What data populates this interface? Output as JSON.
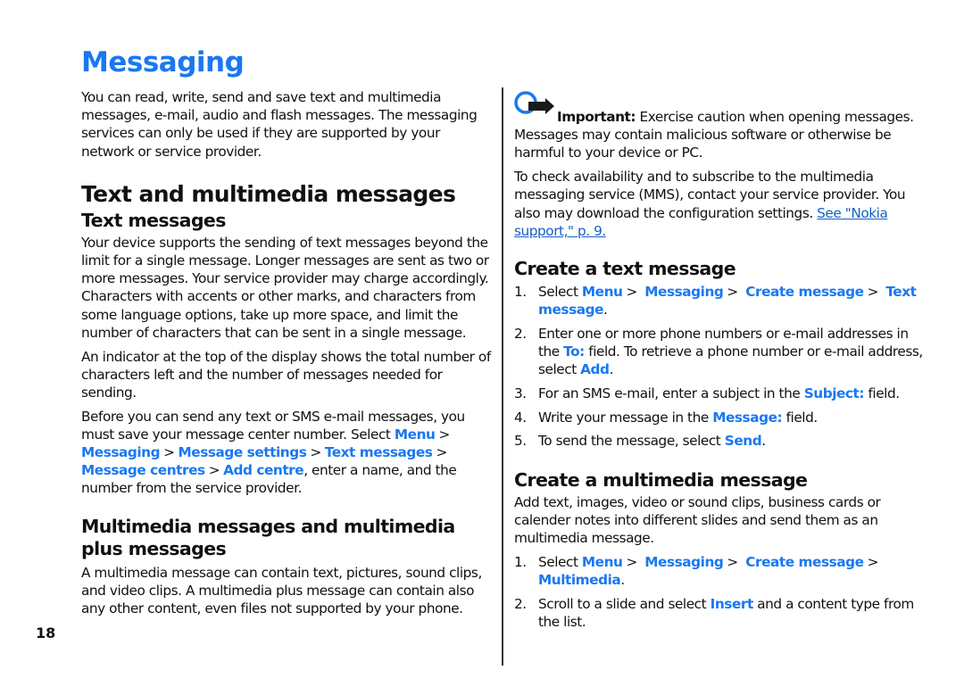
{
  "page": {
    "title": "Messaging",
    "page_number": "18",
    "accent_color": "#1a78f0"
  },
  "left": {
    "intro": "You can read, write, send and save text and multimedia messages, e-mail, audio and flash messages. The messaging services can only be used if they are supported by your network or service provider.",
    "section_title": "Text and multimedia messages",
    "text_messages": {
      "heading": "Text messages",
      "para1": "Your device supports the sending of text messages beyond the limit for a single message. Longer messages are sent as two or more messages. Your service provider may charge accordingly. Characters with accents or other marks, and characters from some language options, take up more space, and limit the number of characters that can be sent in a single message.",
      "para2": "An indicator at the top of the display shows the total number of characters left and the number of messages needed for sending.",
      "para3_pre": "Before you can send any text or SMS e-mail messages, you must save your message center number. Select ",
      "para3_path": [
        "Menu",
        "Messaging",
        "Message settings",
        "Text messages",
        "Message centres",
        "Add centre"
      ],
      "para3_post": ", enter a name, and the number from the service provider.",
      "separator": ">"
    },
    "mms": {
      "heading": "Multimedia messages and multimedia plus messages",
      "para": "A multimedia message can contain text, pictures, sound clips, and video clips. A multimedia plus message can contain also any other content, even files not supported by your phone."
    }
  },
  "right": {
    "important": {
      "icon": "important-hand-icon",
      "label": "Important:",
      "text": " Exercise caution when opening messages. Messages may contain malicious software or otherwise be harmful to your device or PC."
    },
    "mms_availability": {
      "text": "To check availability and to subscribe to the multimedia messaging service (MMS), contact your service provider. You also may download the configuration settings. ",
      "link": "See \"Nokia support,\" p. 9."
    },
    "create_text": {
      "heading": "Create a text message",
      "steps": [
        {
          "num": "1.",
          "pre": "Select ",
          "path": [
            "Menu",
            "Messaging",
            "Create message",
            "Text message"
          ],
          "post": "."
        },
        {
          "num": "2.",
          "pre": "Enter one or more phone numbers or e-mail addresses in the ",
          "ui": "To:",
          "mid": " field. To retrieve a phone number or e-mail address, select ",
          "ui2": "Add",
          "post": "."
        },
        {
          "num": "3.",
          "pre": "For an SMS e-mail, enter a subject in the ",
          "ui": "Subject:",
          "post": " field."
        },
        {
          "num": "4.",
          "pre": "Write your message in the ",
          "ui": "Message:",
          "post": " field."
        },
        {
          "num": "5.",
          "pre": "To send the message, select ",
          "ui": "Send",
          "post": "."
        }
      ]
    },
    "create_mms": {
      "heading": "Create a multimedia message",
      "intro": "Add text, images, video or sound clips, business cards or calender notes into different slides and send them as an multimedia message.",
      "steps": [
        {
          "num": "1.",
          "pre": "Select ",
          "path": [
            "Menu",
            "Messaging",
            "Create message",
            "Multimedia"
          ],
          "post": "."
        },
        {
          "num": "2.",
          "pre": "Scroll to a slide and select ",
          "ui": "Insert",
          "post": " and a content type from the list."
        }
      ]
    }
  }
}
